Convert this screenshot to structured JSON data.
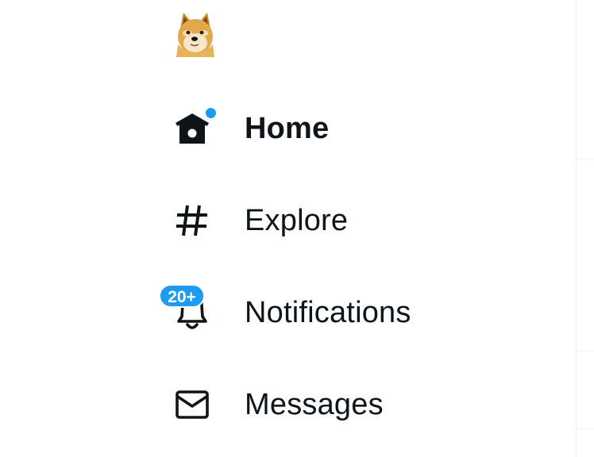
{
  "brand": {
    "logo_icon": "doge-icon"
  },
  "colors": {
    "accent": "#1d9bf0",
    "text": "#0f1419",
    "divider": "#eff3f4"
  },
  "nav": {
    "items": [
      {
        "label": "Home",
        "icon": "home-icon",
        "active": true,
        "has_new_dot": true
      },
      {
        "label": "Explore",
        "icon": "hashtag-icon",
        "active": false
      },
      {
        "label": "Notifications",
        "icon": "bell-icon",
        "active": false,
        "badge": "20+"
      },
      {
        "label": "Messages",
        "icon": "envelope-icon",
        "active": false
      }
    ]
  }
}
